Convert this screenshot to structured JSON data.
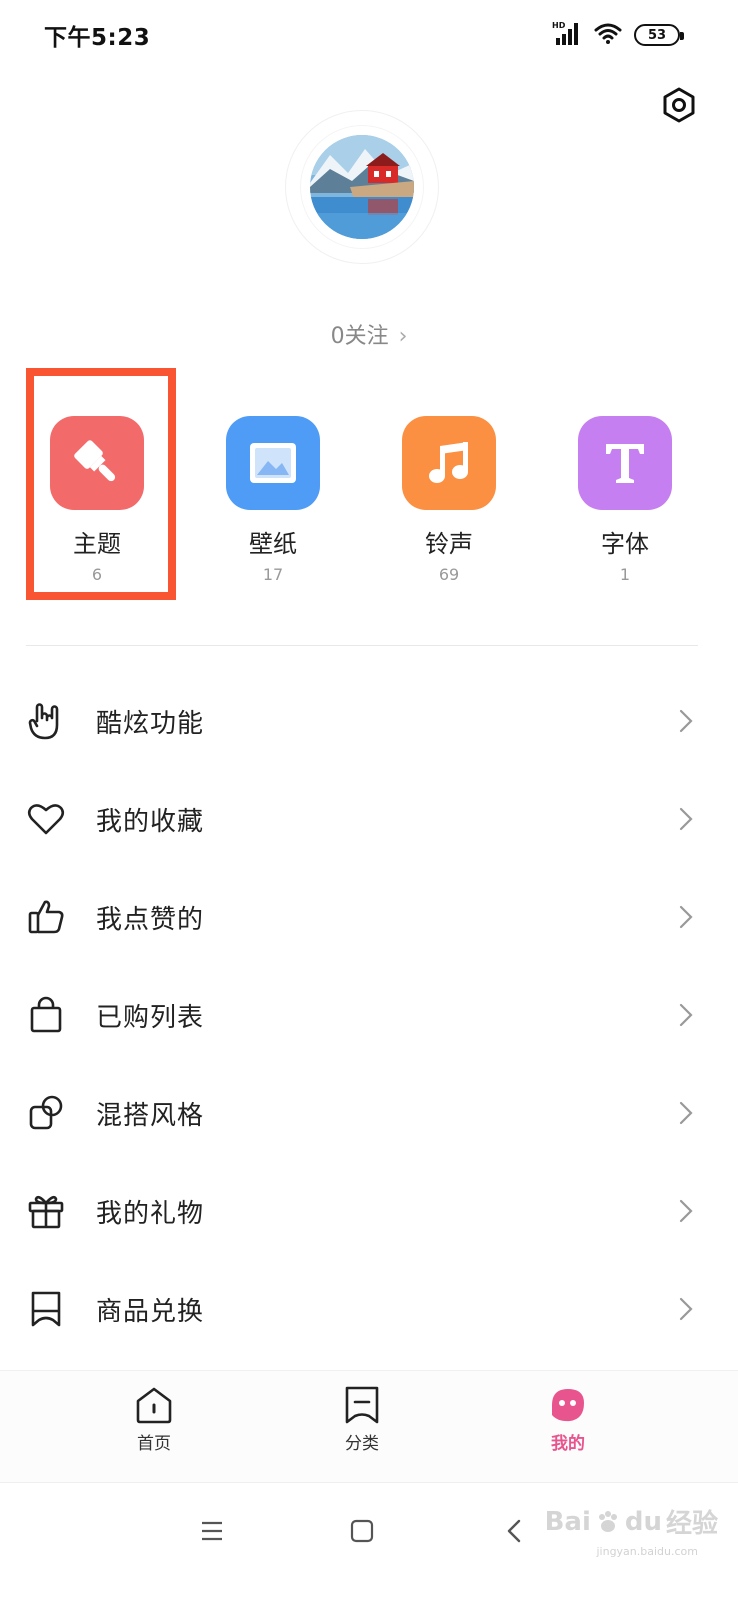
{
  "status_bar": {
    "time": "下午5:23",
    "battery": "53",
    "network": "HD"
  },
  "profile": {
    "follow_text": "0关注",
    "chevron": "›"
  },
  "shortcuts": [
    {
      "label": "主题",
      "count": "6",
      "color": "#f36a6a",
      "icon": "brush-icon"
    },
    {
      "label": "壁纸",
      "count": "17",
      "color": "#4e9cf6",
      "icon": "image-icon"
    },
    {
      "label": "铃声",
      "count": "69",
      "color": "#fb9042",
      "icon": "music-note-icon"
    },
    {
      "label": "字体",
      "count": "1",
      "color": "#c67ff0",
      "icon": "font-t-icon"
    }
  ],
  "menu": [
    {
      "label": "酷炫功能",
      "icon": "rock-hand-icon"
    },
    {
      "label": "我的收藏",
      "icon": "heart-icon"
    },
    {
      "label": "我点赞的",
      "icon": "thumbs-up-icon"
    },
    {
      "label": "已购列表",
      "icon": "shopping-bag-icon"
    },
    {
      "label": "混搭风格",
      "icon": "mix-shapes-icon"
    },
    {
      "label": "我的礼物",
      "icon": "gift-icon"
    },
    {
      "label": "商品兑换",
      "icon": "ticket-icon"
    }
  ],
  "bottom_nav": {
    "home": "首页",
    "category": "分类",
    "mine": "我的",
    "active_color": "#e8558e"
  },
  "watermark": {
    "brand": "Bai",
    "brand2": "du",
    "brand_cn": "经验",
    "url": "jingyan.baidu.com"
  },
  "colors": {
    "highlight": "#fa5533"
  }
}
